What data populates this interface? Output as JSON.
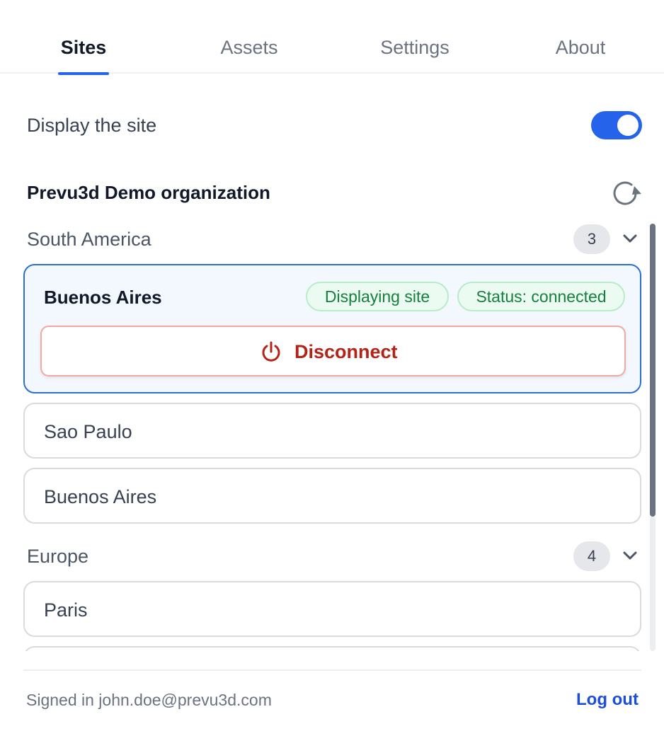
{
  "tabs": [
    {
      "label": "Sites",
      "active": true
    },
    {
      "label": "Assets",
      "active": false
    },
    {
      "label": "Settings",
      "active": false
    },
    {
      "label": "About",
      "active": false
    }
  ],
  "display": {
    "label": "Display the site",
    "enabled": true
  },
  "organization": {
    "name": "Prevu3d Demo organization",
    "refresh_icon": "refresh-icon"
  },
  "groups": [
    {
      "name": "South America",
      "count": "3",
      "expanded_icon": "chevron-down-icon",
      "active_site": {
        "name": "Buenos Aires",
        "badges": [
          "Displaying site",
          "Status: connected"
        ],
        "disconnect_label": "Disconnect",
        "disconnect_icon": "power-icon"
      },
      "sites": [
        "Sao Paulo",
        "Buenos Aires"
      ]
    },
    {
      "name": "Europe",
      "count": "4",
      "expanded_icon": "chevron-down-icon",
      "sites": [
        "Paris"
      ]
    }
  ],
  "footer": {
    "signed_in": "Signed in john.doe@prevu3d.com",
    "logout_label": "Log out"
  },
  "colors": {
    "accent": "#2563eb",
    "success_text": "#15803d",
    "danger_text": "#b42318",
    "danger_border": "#f4a7a1"
  }
}
